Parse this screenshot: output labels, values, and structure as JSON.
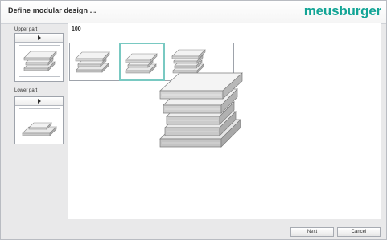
{
  "window": {
    "title": "Define modular design ...",
    "brand": "meusburger",
    "brand_color": "#13a596"
  },
  "sidebar": {
    "upper": {
      "label": "Upper part",
      "header_icon": "play-arrow-icon"
    },
    "lower": {
      "label": "Lower part",
      "header_icon": "play-arrow-icon"
    }
  },
  "main": {
    "value_label": "100",
    "options": [
      {
        "name": "option-1"
      },
      {
        "name": "option-2",
        "selected": true
      },
      {
        "name": "option-3"
      }
    ]
  },
  "footer": {
    "next_label": "Next",
    "cancel_label": "Cancel"
  },
  "colors": {
    "selection_border": "#79c9c2"
  }
}
